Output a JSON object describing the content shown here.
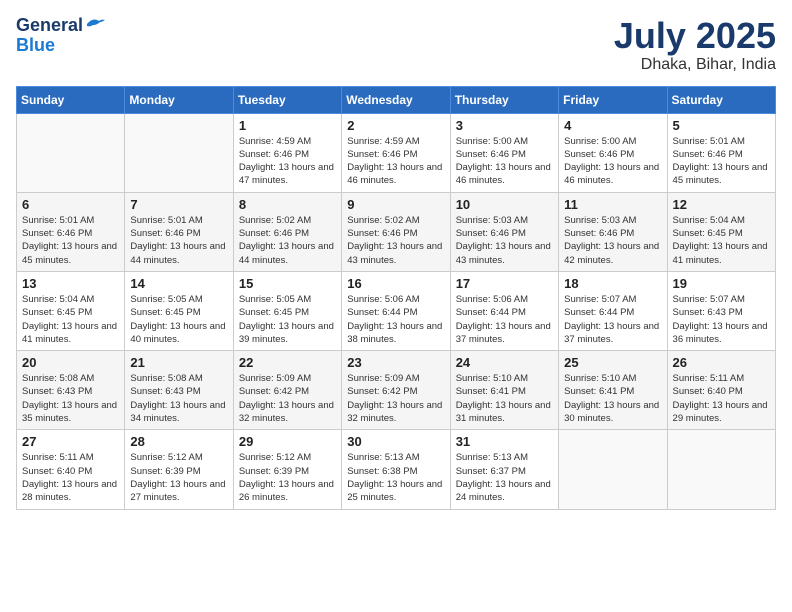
{
  "logo": {
    "line1": "General",
    "line2": "Blue"
  },
  "title": "July 2025",
  "subtitle": "Dhaka, Bihar, India",
  "weekdays": [
    "Sunday",
    "Monday",
    "Tuesday",
    "Wednesday",
    "Thursday",
    "Friday",
    "Saturday"
  ],
  "weeks": [
    [
      {
        "day": "",
        "info": ""
      },
      {
        "day": "",
        "info": ""
      },
      {
        "day": "1",
        "info": "Sunrise: 4:59 AM\nSunset: 6:46 PM\nDaylight: 13 hours and 47 minutes."
      },
      {
        "day": "2",
        "info": "Sunrise: 4:59 AM\nSunset: 6:46 PM\nDaylight: 13 hours and 46 minutes."
      },
      {
        "day": "3",
        "info": "Sunrise: 5:00 AM\nSunset: 6:46 PM\nDaylight: 13 hours and 46 minutes."
      },
      {
        "day": "4",
        "info": "Sunrise: 5:00 AM\nSunset: 6:46 PM\nDaylight: 13 hours and 46 minutes."
      },
      {
        "day": "5",
        "info": "Sunrise: 5:01 AM\nSunset: 6:46 PM\nDaylight: 13 hours and 45 minutes."
      }
    ],
    [
      {
        "day": "6",
        "info": "Sunrise: 5:01 AM\nSunset: 6:46 PM\nDaylight: 13 hours and 45 minutes."
      },
      {
        "day": "7",
        "info": "Sunrise: 5:01 AM\nSunset: 6:46 PM\nDaylight: 13 hours and 44 minutes."
      },
      {
        "day": "8",
        "info": "Sunrise: 5:02 AM\nSunset: 6:46 PM\nDaylight: 13 hours and 44 minutes."
      },
      {
        "day": "9",
        "info": "Sunrise: 5:02 AM\nSunset: 6:46 PM\nDaylight: 13 hours and 43 minutes."
      },
      {
        "day": "10",
        "info": "Sunrise: 5:03 AM\nSunset: 6:46 PM\nDaylight: 13 hours and 43 minutes."
      },
      {
        "day": "11",
        "info": "Sunrise: 5:03 AM\nSunset: 6:46 PM\nDaylight: 13 hours and 42 minutes."
      },
      {
        "day": "12",
        "info": "Sunrise: 5:04 AM\nSunset: 6:45 PM\nDaylight: 13 hours and 41 minutes."
      }
    ],
    [
      {
        "day": "13",
        "info": "Sunrise: 5:04 AM\nSunset: 6:45 PM\nDaylight: 13 hours and 41 minutes."
      },
      {
        "day": "14",
        "info": "Sunrise: 5:05 AM\nSunset: 6:45 PM\nDaylight: 13 hours and 40 minutes."
      },
      {
        "day": "15",
        "info": "Sunrise: 5:05 AM\nSunset: 6:45 PM\nDaylight: 13 hours and 39 minutes."
      },
      {
        "day": "16",
        "info": "Sunrise: 5:06 AM\nSunset: 6:44 PM\nDaylight: 13 hours and 38 minutes."
      },
      {
        "day": "17",
        "info": "Sunrise: 5:06 AM\nSunset: 6:44 PM\nDaylight: 13 hours and 37 minutes."
      },
      {
        "day": "18",
        "info": "Sunrise: 5:07 AM\nSunset: 6:44 PM\nDaylight: 13 hours and 37 minutes."
      },
      {
        "day": "19",
        "info": "Sunrise: 5:07 AM\nSunset: 6:43 PM\nDaylight: 13 hours and 36 minutes."
      }
    ],
    [
      {
        "day": "20",
        "info": "Sunrise: 5:08 AM\nSunset: 6:43 PM\nDaylight: 13 hours and 35 minutes."
      },
      {
        "day": "21",
        "info": "Sunrise: 5:08 AM\nSunset: 6:43 PM\nDaylight: 13 hours and 34 minutes."
      },
      {
        "day": "22",
        "info": "Sunrise: 5:09 AM\nSunset: 6:42 PM\nDaylight: 13 hours and 32 minutes."
      },
      {
        "day": "23",
        "info": "Sunrise: 5:09 AM\nSunset: 6:42 PM\nDaylight: 13 hours and 32 minutes."
      },
      {
        "day": "24",
        "info": "Sunrise: 5:10 AM\nSunset: 6:41 PM\nDaylight: 13 hours and 31 minutes."
      },
      {
        "day": "25",
        "info": "Sunrise: 5:10 AM\nSunset: 6:41 PM\nDaylight: 13 hours and 30 minutes."
      },
      {
        "day": "26",
        "info": "Sunrise: 5:11 AM\nSunset: 6:40 PM\nDaylight: 13 hours and 29 minutes."
      }
    ],
    [
      {
        "day": "27",
        "info": "Sunrise: 5:11 AM\nSunset: 6:40 PM\nDaylight: 13 hours and 28 minutes."
      },
      {
        "day": "28",
        "info": "Sunrise: 5:12 AM\nSunset: 6:39 PM\nDaylight: 13 hours and 27 minutes."
      },
      {
        "day": "29",
        "info": "Sunrise: 5:12 AM\nSunset: 6:39 PM\nDaylight: 13 hours and 26 minutes."
      },
      {
        "day": "30",
        "info": "Sunrise: 5:13 AM\nSunset: 6:38 PM\nDaylight: 13 hours and 25 minutes."
      },
      {
        "day": "31",
        "info": "Sunrise: 5:13 AM\nSunset: 6:37 PM\nDaylight: 13 hours and 24 minutes."
      },
      {
        "day": "",
        "info": ""
      },
      {
        "day": "",
        "info": ""
      }
    ]
  ]
}
